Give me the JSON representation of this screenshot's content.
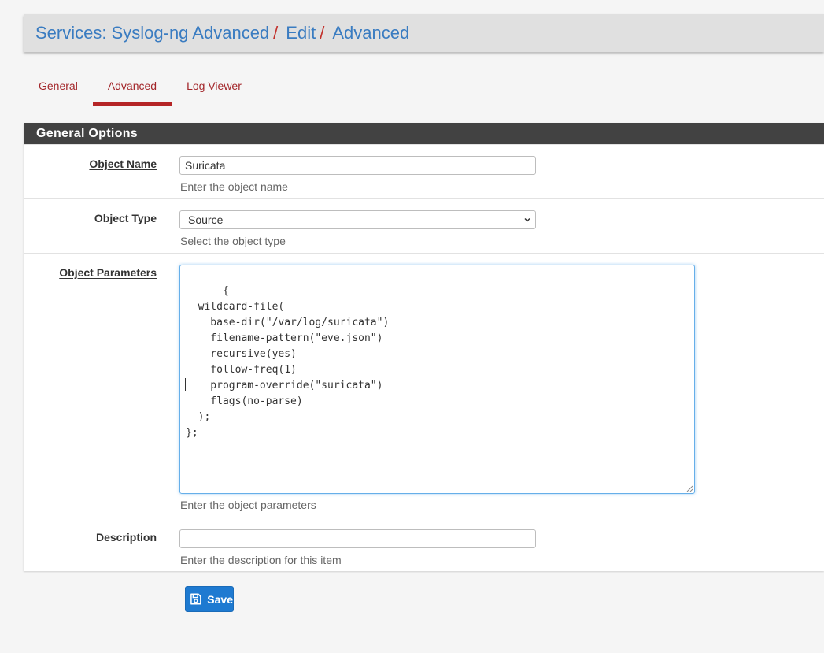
{
  "breadcrumb": {
    "items": [
      "Services: Syslog-ng Advanced",
      "Edit",
      "Advanced"
    ],
    "separator": "/"
  },
  "tabs": [
    {
      "label": "General",
      "active": false
    },
    {
      "label": "Advanced",
      "active": true
    },
    {
      "label": "Log Viewer",
      "active": false
    }
  ],
  "panel": {
    "heading": "General Options",
    "object_name": {
      "label": "Object Name",
      "value": "Suricata",
      "help": "Enter the object name"
    },
    "object_type": {
      "label": "Object Type",
      "selected": "Source",
      "help": "Select the object type"
    },
    "object_parameters": {
      "label": "Object Parameters",
      "value": "{\n  wildcard-file(\n    base-dir(\"/var/log/suricata\")\n    filename-pattern(\"eve.json\")\n    recursive(yes)\n    follow-freq(1)\n    program-override(\"suricata\")\n    flags(no-parse)\n  );\n};",
      "help": "Enter the object parameters"
    },
    "description": {
      "label": "Description",
      "value": "",
      "help": "Enter the description for this item"
    }
  },
  "actions": {
    "save_label": "Save"
  },
  "colors": {
    "link_blue": "#3a7cc1",
    "accent_red": "#b52526",
    "heading_bg": "#424242",
    "button_blue": "#1e7ad1"
  },
  "icons": {
    "save": "floppy-disk-icon",
    "select_arrow": "chevron-down-icon"
  }
}
